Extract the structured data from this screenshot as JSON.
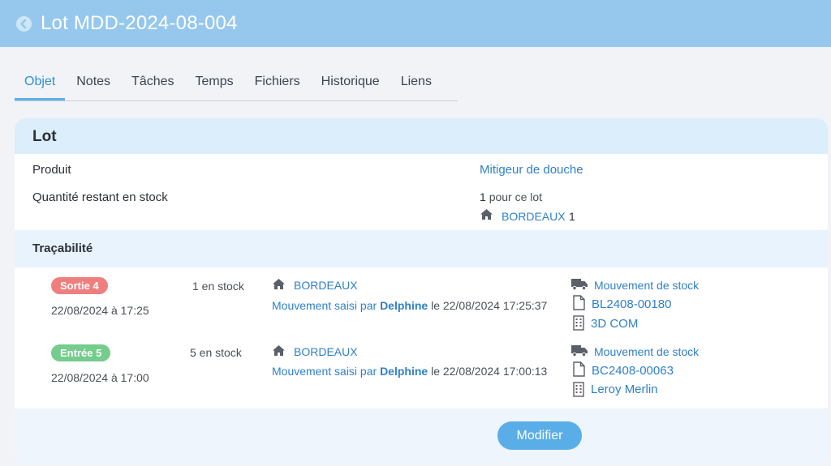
{
  "header": {
    "title": "Lot MDD-2024-08-004"
  },
  "tabs": [
    {
      "label": "Objet",
      "active": true
    },
    {
      "label": "Notes"
    },
    {
      "label": "Tâches"
    },
    {
      "label": "Temps"
    },
    {
      "label": "Fichiers"
    },
    {
      "label": "Historique"
    },
    {
      "label": "Liens"
    }
  ],
  "lot": {
    "title": "Lot",
    "product_label": "Produit",
    "product_value": "Mitigeur de douche",
    "qty_label": "Quantité restant en stock",
    "qty_number": "1",
    "qty_suffix": "pour ce lot",
    "warehouse": "BORDEAUX",
    "warehouse_qty": "1"
  },
  "traceability": {
    "title": "Traçabilité",
    "rows": [
      {
        "badge": "Sortie 4",
        "badge_color": "#ef7f7f",
        "date": "22/08/2024 à 17:25",
        "stock": "1 en stock",
        "warehouse": "BORDEAUX",
        "mvt_prefix": "Mouvement saisi par",
        "user": "Delphine",
        "mvt_date": "le 22/08/2024 17:25:37",
        "link_movement": "Mouvement de stock",
        "link_doc": "BL2408-00180",
        "link_company": "3D COM"
      },
      {
        "badge": "Entrée 5",
        "badge_color": "#74cc8d",
        "date": "22/08/2024 à 17:00",
        "stock": "5 en stock",
        "warehouse": "BORDEAUX",
        "mvt_prefix": "Mouvement saisi par",
        "user": "Delphine",
        "mvt_date": "le 22/08/2024 17:00:13",
        "link_movement": "Mouvement de stock",
        "link_doc": "BC2408-00063",
        "link_company": "Leroy Merlin"
      }
    ]
  },
  "footer": {
    "modify_label": "Modifier"
  },
  "colors": {
    "accent": "#2f80c7",
    "header_bg": "#96c8ee",
    "button": "#5aaee8"
  },
  "icons": [
    "back-arrow-icon",
    "home-icon",
    "truck-icon",
    "file-icon",
    "building-icon"
  ]
}
